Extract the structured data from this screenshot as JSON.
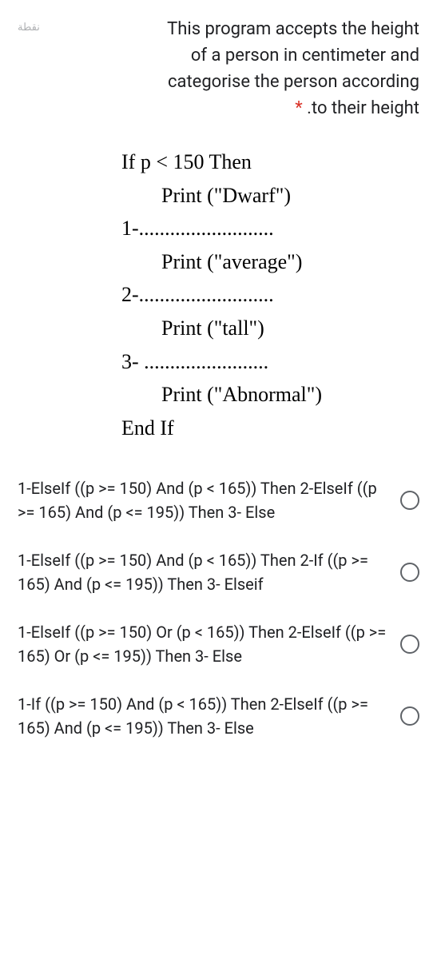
{
  "points_label": "نقطة",
  "question": {
    "line1": "This program accepts the height",
    "line2": "of a person in centimeter and",
    "line3": "categorise the person according",
    "line4_suffix": ".to their height",
    "required": "*"
  },
  "code": {
    "l1": "If p < 150 Then",
    "l2": "Print (\"Dwarf\")",
    "l3": "1-..........................",
    "l4": "Print (\"average\")",
    "l5": "2-..........................",
    "l6": "Print (\"tall\")",
    "l7": "3- ........................",
    "l8": "Print (\"Abnormal\")",
    "l9": "End If"
  },
  "options": [
    {
      "text": "1-ElseIf ((p >= 150) And (p < 165)) Then 2-ElseIf ((p >= 165) And (p <= 195)) Then 3- Else"
    },
    {
      "text": "1-ElseIf ((p >= 150) And (p < 165)) Then 2-If ((p >= 165) And (p <= 195)) Then 3- Elseif"
    },
    {
      "text": "1-ElseIf ((p >= 150) Or (p < 165)) Then 2-ElseIf ((p >= 165) Or (p <= 195)) Then 3- Else"
    },
    {
      "text": "1-If ((p >= 150) And (p < 165)) Then 2-ElseIf ((p >= 165) And (p <= 195)) Then 3- Else"
    }
  ]
}
